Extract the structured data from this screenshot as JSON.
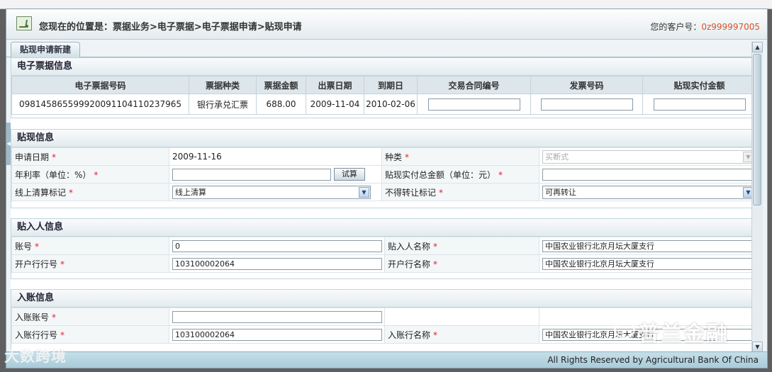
{
  "header": {
    "breadcrumb": "您现在的位置是：票据业务>电子票据>电子票据申请>贴现申请",
    "customer_label": "您的客户号：",
    "customer_number": "0z999997005"
  },
  "tab": {
    "label": "贴现申请新建"
  },
  "bill_info": {
    "title": "电子票据信息",
    "columns": [
      "电子票据号码",
      "票据种类",
      "票据金额",
      "出票日期",
      "到期日",
      "交易合同编号",
      "发票号码",
      "贴现实付金额"
    ],
    "row": {
      "bill_number": "0981458655999200911041102379​65",
      "bill_type": "银行承兑汇票",
      "amount": "688.00",
      "issue_date": "2009-11-04",
      "due_date": "2010-02-06",
      "contract_no": "",
      "invoice_no": "",
      "actual_amount": ""
    }
  },
  "discount_info": {
    "title": "贴现信息",
    "apply_date_label": "申请日期",
    "apply_date": "2009-11-16",
    "kind_label": "种类",
    "kind_value": "买断式",
    "rate_label": "年利率（单位：%）",
    "rate_value": "",
    "calc_button": "试算",
    "total_label": "贴现实付总金额（单位：元）",
    "total_value": "",
    "online_label": "线上清算标记",
    "online_value": "线上清算",
    "transfer_label": "不得转让标记",
    "transfer_value": "可再转让"
  },
  "discountee_info": {
    "title": "贴入人信息",
    "account_label": "账号",
    "account_value": "0",
    "name_label": "贴入人名称",
    "name_value": "中国农业银行北京月坛大厦支行",
    "bank_no_label": "开户行行号",
    "bank_no_value": "103100002064",
    "bank_name_label": "开户行名称",
    "bank_name_value": "中国农业银行北京月坛大厦支行"
  },
  "credit_info": {
    "title": "入账信息",
    "account_label": "入账账号",
    "account_value": "",
    "bank_no_label": "入账行行号",
    "bank_no_value": "103100002064",
    "bank_name_label": "入账行名称",
    "bank_name_value": "中国农业银行北京月坛大厦支行"
  },
  "required_mark": "*",
  "footer": {
    "copyright": "All Rights Reserved by Agricultural Bank Of China"
  },
  "watermarks": {
    "left": "大数跨境",
    "right": "普兰金融"
  },
  "colors": {
    "accent": "#d9532b",
    "header_bg": "#e4ecef",
    "required": "#dd2233"
  }
}
